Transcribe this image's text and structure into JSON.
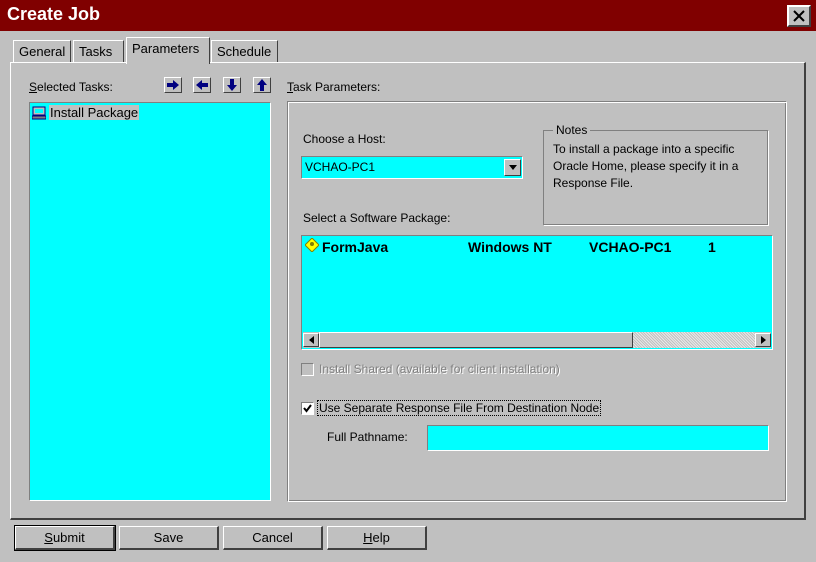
{
  "window": {
    "title": "Create Job"
  },
  "tabs": [
    {
      "label": "General"
    },
    {
      "label": "Tasks"
    },
    {
      "label": "Parameters"
    },
    {
      "label": "Schedule"
    }
  ],
  "selected_tasks": {
    "label": "Selected Tasks:",
    "items": [
      {
        "label": "Install Package",
        "icon": "computer-icon"
      }
    ]
  },
  "task_parameters": {
    "label": "Task Parameters:",
    "choose_host_label": "Choose a Host:",
    "host_value": "VCHAO-PC1",
    "notes_title": "Notes",
    "notes_lines": [
      "To install a package into a specific",
      "Oracle Home, please specify it in a",
      "Response File."
    ],
    "software_package_label": "Select a Software Package:",
    "packages": [
      {
        "name": "FormJava",
        "platform": "Windows NT",
        "host": "VCHAO-PC1",
        "version": "1"
      }
    ],
    "install_shared_label": "Install Shared (available for client installation)",
    "install_shared_checked": false,
    "use_response_file_label": "Use Separate Response File From Destination Node",
    "use_response_file_checked": true,
    "full_pathname_label": "Full Pathname:",
    "full_pathname_value": ""
  },
  "buttons": {
    "submit": "Submit",
    "save": "Save",
    "cancel": "Cancel",
    "help": "Help"
  },
  "colors": {
    "titlebar": "#800000",
    "list_background": "#00ffff",
    "face": "#c0c0c0"
  }
}
